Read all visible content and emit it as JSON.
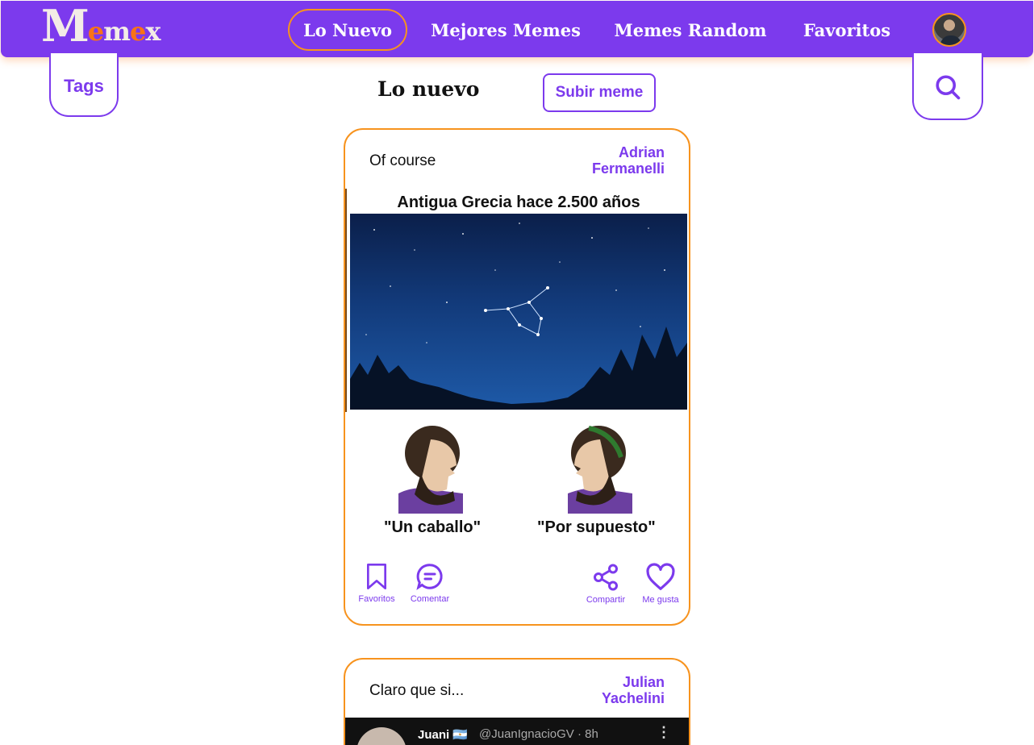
{
  "nav": {
    "logo": {
      "m": "M",
      "e1": "e",
      "m2": "m",
      "e2": "e",
      "x": "x"
    },
    "links": [
      "Lo Nuevo",
      "Mejores Memes",
      "Memes Random",
      "Favoritos"
    ]
  },
  "tags_label": "Tags",
  "page_title": "Lo nuevo",
  "upload_label": "Subir meme",
  "posts": [
    {
      "title": "Of course",
      "author_first": "Adrian",
      "author_last": "Fermanelli",
      "meme_caption": "Antigua Grecia hace 2.500 años",
      "left_label": "\"Un caballo\"",
      "right_label": "\"Por supuesto\"",
      "actions": {
        "fav": "Favoritos",
        "comment": "Comentar",
        "share": "Compartir",
        "like": "Me gusta"
      }
    },
    {
      "title": "Claro que si...",
      "author_first": "Julian",
      "author_last": "Yachelini",
      "tweet_name": "Juani 🇦🇷",
      "tweet_handle": "@JuanIgnacioGV · 8h"
    }
  ],
  "colors": {
    "primary": "#7c3aed",
    "accent": "#f7931e"
  }
}
